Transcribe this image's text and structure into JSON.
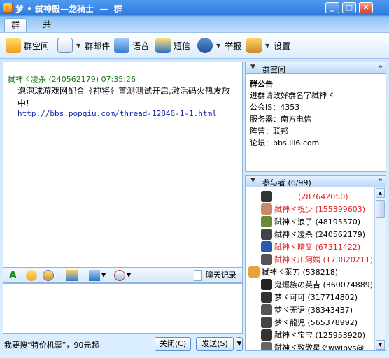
{
  "window": {
    "title": "梦 • 弑神殿—龙骑士  —  群"
  },
  "tabs": [
    "群聊",
    "共享"
  ],
  "toolbar": [
    {
      "label": "群空间",
      "icon": "group-space-icon"
    },
    {
      "label": "群邮件",
      "icon": "mail-icon"
    },
    {
      "label": "语音",
      "icon": "voice-icon"
    },
    {
      "label": "短信",
      "icon": "sms-icon"
    },
    {
      "label": "举报",
      "icon": "report-icon"
    },
    {
      "label": "设置",
      "icon": "settings-icon"
    }
  ],
  "message": {
    "sender": "弑神ヾ凌杀 (240562179) 07:35:26",
    "body": "泡泡球游戏网配合《神将》首测测试开启,激活码火热发放中!",
    "link": "http://bbs.popqiu.com/thread-12846-1-1.html"
  },
  "input_toolbar": {
    "history_label": "聊天记录"
  },
  "bottom": {
    "ad_text": "我要搜“特价机票”，90元起",
    "close_label": "关闭(C)",
    "send_label": "发送(S)"
  },
  "group_space": {
    "header": "群空间",
    "notice_title": "群公告",
    "lines": [
      "进群请改好群名字弑神ヾ",
      "公会IS：4353",
      "服务器：南方电信",
      "阵营：联邦",
      "论坛：bbs.iii6.com"
    ]
  },
  "members": {
    "header": "参与者 (6/99)",
    "list": [
      {
        "name": "(287642050)",
        "color": "#e02020"
      },
      {
        "name": "弑神ヾ祝少 (155399603)",
        "color": "#e02020"
      },
      {
        "name": "弑神ヾ浪子 (48195570)",
        "color": "#000000"
      },
      {
        "name": "弑神ヾ凌杀 (240562179)",
        "color": "#000000"
      },
      {
        "name": "弑神ヾ暗叉 (67311422)",
        "color": "#e02020"
      },
      {
        "name": "弑神ヾ川阿姨 (173820211)",
        "color": "#e02020"
      },
      {
        "name": "弑神ヾ莱刀 (538218)",
        "color": "#000000"
      },
      {
        "name": "鬼爆族の英吉 (360074889)",
        "color": "#000000"
      },
      {
        "name": "梦ヾ可可 (317714802)",
        "color": "#000000"
      },
      {
        "name": "梦ヾ无语 (38343437)",
        "color": "#000000"
      },
      {
        "name": "梦ヾ龍児 (565378992)",
        "color": "#000000"
      },
      {
        "name": "弑神ヾ宝宝 (125953920)",
        "color": "#000000"
      },
      {
        "name": "弑神ヾ致敬星ぐwwjbys@",
        "color": "#000000"
      }
    ]
  }
}
